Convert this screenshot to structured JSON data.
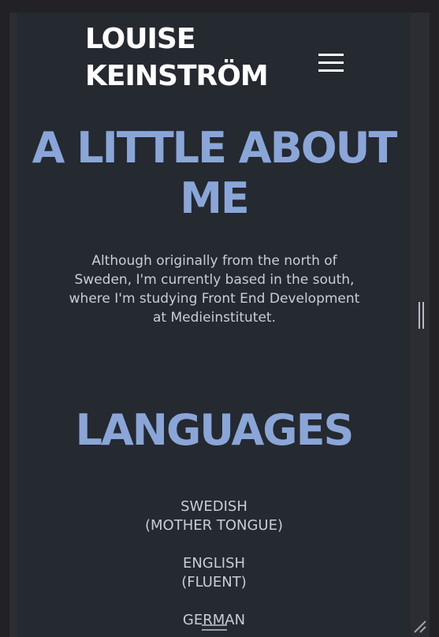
{
  "header": {
    "brand_line1": "LOUISE",
    "brand_line2": "KEINSTRÖM",
    "menu_icon": "hamburger-menu-icon"
  },
  "about": {
    "heading_line1": "A LITTLE ABOUT",
    "heading_line2": "ME",
    "text": "Although originally from the north of Sweden, I'm currently based in the south, where I'm studying Front End Development at Medieinstitutet."
  },
  "languages": {
    "heading": "LANGUAGES",
    "items": [
      {
        "name": "SWEDISH",
        "level": "(MOTHER TONGUE)"
      },
      {
        "name": "ENGLISH",
        "level": "(FLUENT)"
      },
      {
        "name": "GERMAN",
        "level": ""
      }
    ]
  },
  "colors": {
    "background": "#252930",
    "heading_accent": "#8aa6d8",
    "body_text": "#c9cdd4",
    "brand_text": "#ffffff"
  }
}
